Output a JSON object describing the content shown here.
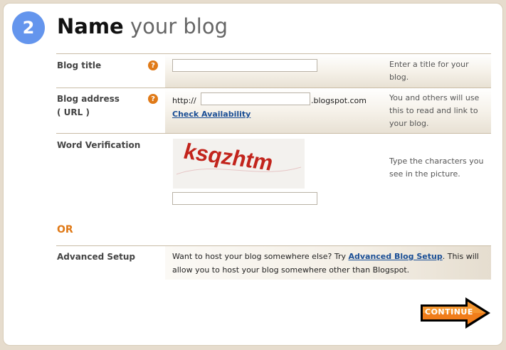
{
  "step": {
    "number": "2",
    "title_bold": "Name",
    "title_rest": "your blog"
  },
  "form": {
    "blog_title": {
      "label": "Blog title",
      "value": "",
      "hint": "Enter a title for your blog."
    },
    "blog_address": {
      "label_line1": "Blog address",
      "label_line2": "( URL )",
      "prefix": "http://",
      "value": "",
      "suffix": ".blogspot.com",
      "check_link": "Check Availability",
      "hint": "You and others will use this to read and link to your blog."
    },
    "word_verification": {
      "label": "Word Verification",
      "captcha_text": "ksqzhtm",
      "value": "",
      "hint": "Type the characters you see in the picture."
    },
    "or_label": "OR",
    "advanced_setup": {
      "label": "Advanced Setup",
      "text_before": "Want to host your blog somewhere else? Try ",
      "link": "Advanced Blog Setup",
      "text_after": ". This will allow you to host your blog somewhere other than Blogspot."
    }
  },
  "continue_label": "CONTINUE",
  "icons": {
    "help": "help-question-icon",
    "arrow": "arrow-right-icon"
  },
  "colors": {
    "accent_orange": "#e07a18",
    "step_blue": "#6495ed",
    "link_blue": "#1a4e95"
  }
}
